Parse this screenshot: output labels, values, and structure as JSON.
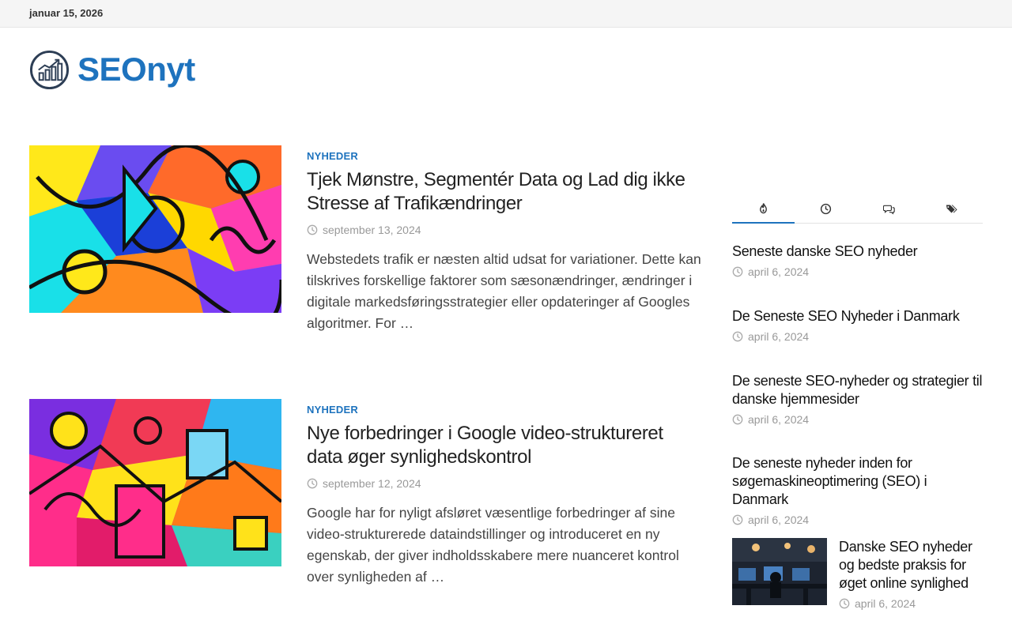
{
  "topbar": {
    "date": "januar 15, 2026"
  },
  "site": {
    "title": "SEOnyt",
    "logo_icon": "chart-growth-icon"
  },
  "posts": [
    {
      "category": "NYHEDER",
      "title": "Tjek Mønstre, Segmentér Data og Lad dig ikke Stresse af Trafikændringer",
      "date": "september 13, 2024",
      "excerpt": "Webstedets trafik er næsten altid udsat for variationer. Dette kan tilskrives forskellige faktorer som sæsonændringer, ændringer i digitale markedsføringsstrategier eller opdateringer af Googles algoritmer. For …"
    },
    {
      "category": "NYHEDER",
      "title": "Nye forbedringer i Google video-struktureret data øger synlighedskontrol",
      "date": "september 12, 2024",
      "excerpt": "Google har for nyligt afsløret væsentlige forbedringer af sine video-strukturerede dataindstillinger og introduceret en ny egenskab, der giver indholdsskabere mere nuanceret kontrol over synligheden af …"
    }
  ],
  "sidebar": {
    "tabs": [
      {
        "icon": "flame-icon",
        "active": true
      },
      {
        "icon": "clock-icon",
        "active": false
      },
      {
        "icon": "comments-icon",
        "active": false
      },
      {
        "icon": "tags-icon",
        "active": false
      }
    ],
    "items": [
      {
        "title": "Seneste danske SEO nyheder",
        "date": "april 6, 2024"
      },
      {
        "title": "De Seneste SEO Nyheder i Danmark",
        "date": "april 6, 2024"
      },
      {
        "title": "De seneste SEO-nyheder og strategier til danske hjemmesider",
        "date": "april 6, 2024"
      },
      {
        "title": "De seneste nyheder inden for søgemaskineoptimering (SEO) i Danmark",
        "date": "april 6, 2024"
      },
      {
        "title": "Danske SEO nyheder og bedste praksis for øget online synlighed",
        "date": "april 6, 2024"
      }
    ]
  },
  "colors": {
    "accent": "#1e73be",
    "text": "#222222",
    "meta": "#999999",
    "topbar_bg": "#f5f5f5"
  }
}
